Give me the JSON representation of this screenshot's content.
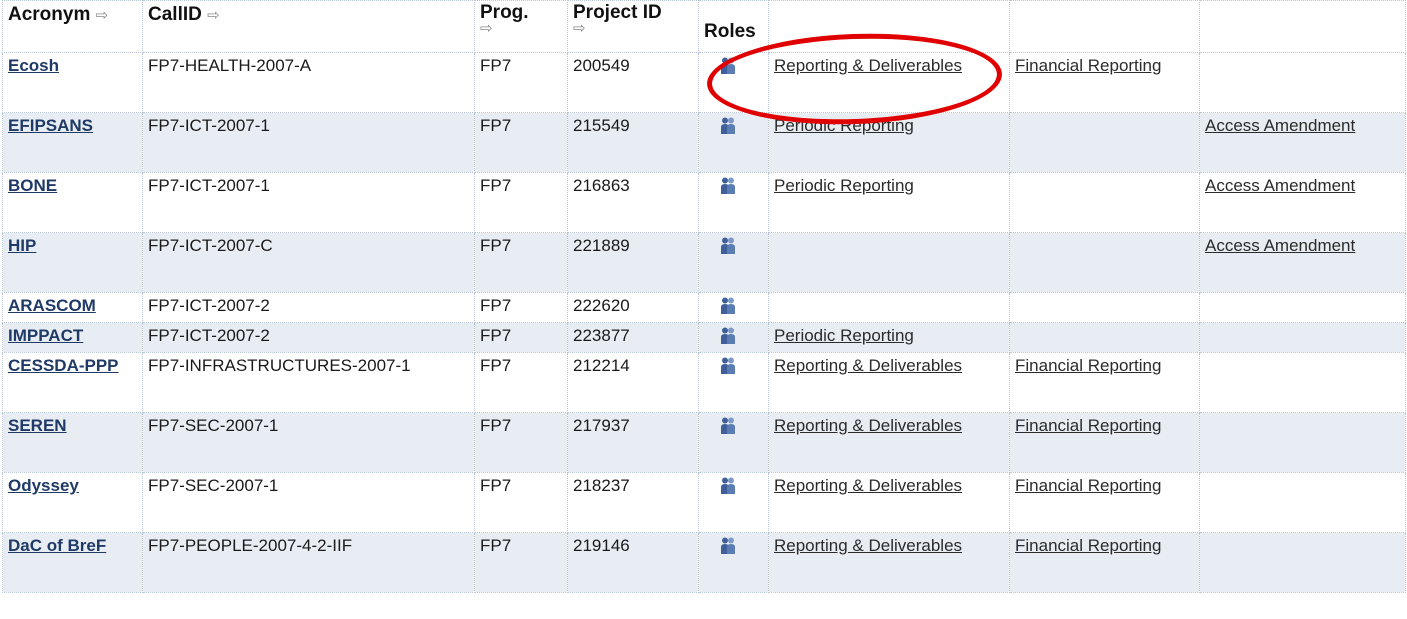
{
  "headers": {
    "acronym": "Acronym",
    "callid": "CallID",
    "prog": "Prog.",
    "project_id": "Project ID",
    "roles": "Roles",
    "sort_icon": "⇨"
  },
  "rows": [
    {
      "acronym": "Ecosh",
      "callid": "FP7-HEALTH-2007-A",
      "prog": "FP7",
      "project_id": "200549",
      "link1": "Reporting & Deliverables",
      "link2": "Financial Reporting",
      "link3": ""
    },
    {
      "acronym": "EFIPSANS",
      "callid": "FP7-ICT-2007-1",
      "prog": "FP7",
      "project_id": "215549",
      "link1": "Periodic Reporting",
      "link2": "",
      "link3": "Access Amendment"
    },
    {
      "acronym": "BONE",
      "callid": "FP7-ICT-2007-1",
      "prog": "FP7",
      "project_id": "216863",
      "link1": "Periodic Reporting",
      "link2": "",
      "link3": "Access Amendment"
    },
    {
      "acronym": "HIP",
      "callid": "FP7-ICT-2007-C",
      "prog": "FP7",
      "project_id": "221889",
      "link1": "",
      "link2": "",
      "link3": "Access Amendment"
    },
    {
      "acronym": "ARASCOM",
      "callid": "FP7-ICT-2007-2",
      "prog": "FP7",
      "project_id": "222620",
      "link1": "",
      "link2": "",
      "link3": ""
    },
    {
      "acronym": "IMPPACT",
      "callid": "FP7-ICT-2007-2",
      "prog": "FP7",
      "project_id": "223877",
      "link1": "Periodic Reporting",
      "link2": "",
      "link3": ""
    },
    {
      "acronym": "CESSDA-PPP",
      "callid": "FP7-INFRASTRUCTURES-2007-1",
      "prog": "FP7",
      "project_id": "212214",
      "link1": "Reporting & Deliverables",
      "link2": "Financial Reporting",
      "link3": ""
    },
    {
      "acronym": "SEREN",
      "callid": "FP7-SEC-2007-1",
      "prog": "FP7",
      "project_id": "217937",
      "link1": "Reporting & Deliverables",
      "link2": "Financial Reporting",
      "link3": ""
    },
    {
      "acronym": "Odyssey",
      "callid": "FP7-SEC-2007-1",
      "prog": "FP7",
      "project_id": "218237",
      "link1": "Reporting & Deliverables",
      "link2": "Financial Reporting",
      "link3": ""
    },
    {
      "acronym": "DaC of BreF",
      "callid": "FP7-PEOPLE-2007-4-2-IIF",
      "prog": "FP7",
      "project_id": "219146",
      "link1": "Reporting & Deliverables",
      "link2": "Financial Reporting",
      "link3": ""
    }
  ],
  "colors": {
    "row_alt": "#e8edf3",
    "acronym_link": "#1f3a66",
    "role_icon": "#3e5f9a",
    "highlight": "#e00000"
  },
  "icons": {
    "role": "people-icon",
    "sort": "arrow-right-icon"
  }
}
